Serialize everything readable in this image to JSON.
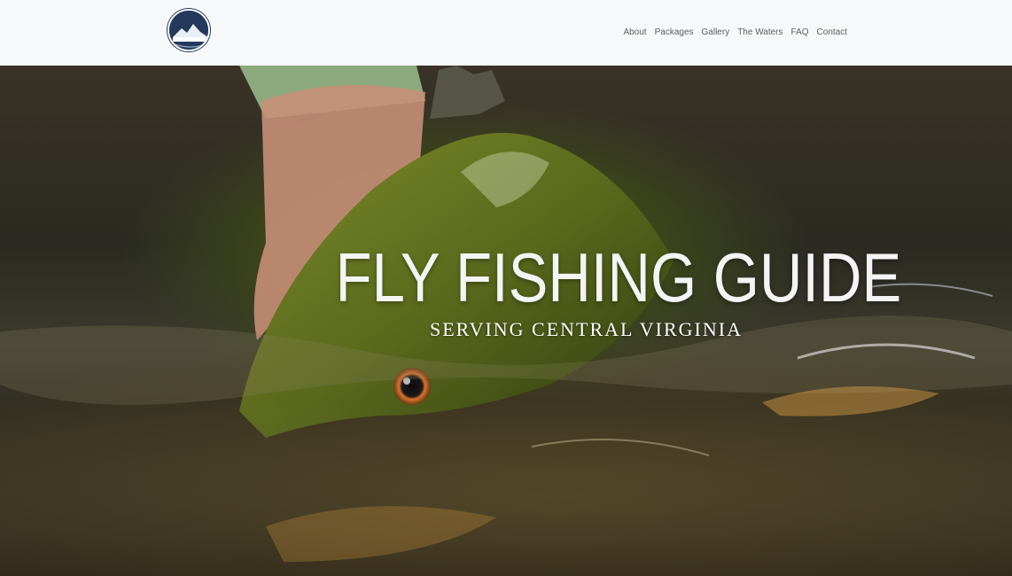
{
  "header": {
    "logo_icon": "blue-mountain-drift-logo-icon",
    "nav": [
      {
        "label": "About"
      },
      {
        "label": "Packages"
      },
      {
        "label": "Gallery"
      },
      {
        "label": "The Waters"
      },
      {
        "label": "FAQ"
      },
      {
        "label": "Contact"
      }
    ]
  },
  "hero": {
    "title": "FLY FISHING GUIDE",
    "subtitle": "SERVING CENTRAL VIRGINIA",
    "image": "hand-holding-smallmouth-bass-in-river"
  },
  "colors": {
    "header_bg": "#f6f8fa",
    "nav_text": "#5b5f66",
    "logo_navy": "#24395c",
    "hero_text": "#f4f4f4"
  }
}
